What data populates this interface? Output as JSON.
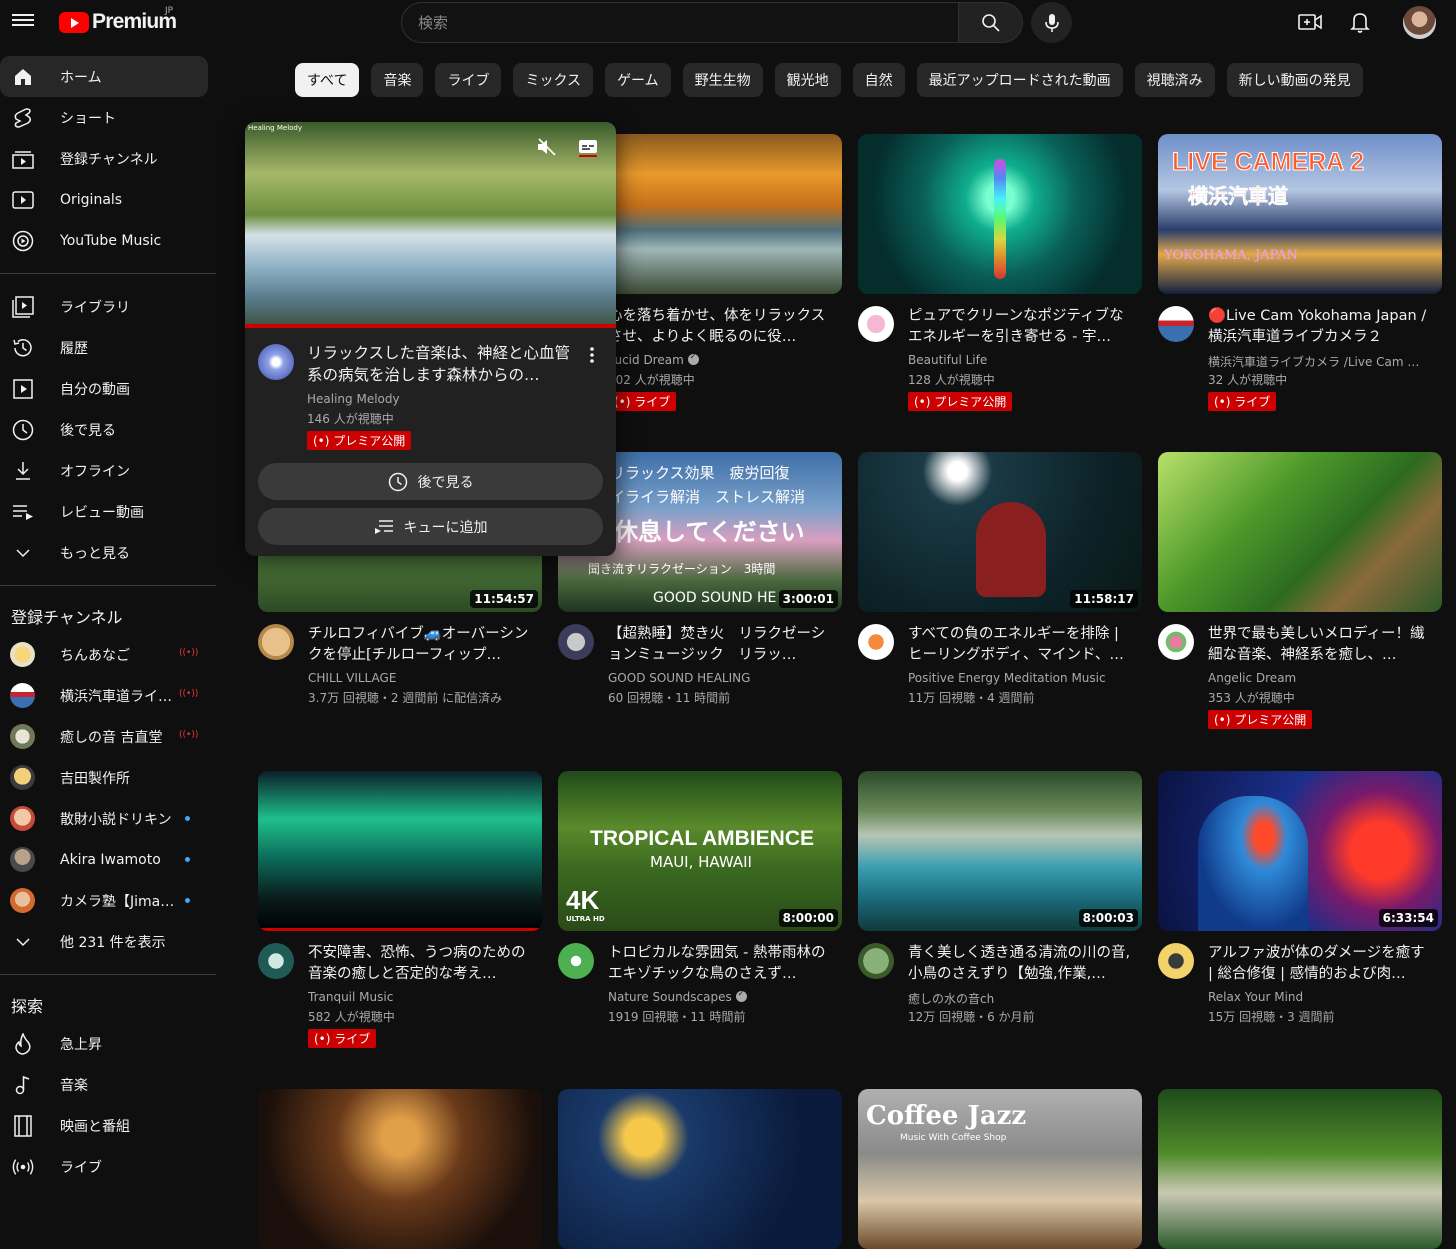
{
  "header": {
    "logo_text": "Premium",
    "region": "JP",
    "search_placeholder": "検索"
  },
  "sidebar": {
    "main": [
      {
        "label": "ホーム",
        "icon": "home-icon"
      },
      {
        "label": "ショート",
        "icon": "shorts-icon"
      },
      {
        "label": "登録チャンネル",
        "icon": "subscriptions-icon"
      },
      {
        "label": "Originals",
        "icon": "originals-icon"
      },
      {
        "label": "YouTube Music",
        "icon": "music-icon"
      }
    ],
    "library": [
      {
        "label": "ライブラリ",
        "icon": "library-icon"
      },
      {
        "label": "履歴",
        "icon": "history-icon"
      },
      {
        "label": "自分の動画",
        "icon": "my-videos-icon"
      },
      {
        "label": "後で見る",
        "icon": "watch-later-icon"
      },
      {
        "label": "オフライン",
        "icon": "download-icon"
      },
      {
        "label": "レビュー動画",
        "icon": "playlist-icon"
      },
      {
        "label": "もっと見る",
        "icon": "chevron-down-icon"
      }
    ],
    "subscriptions_heading": "登録チャンネル",
    "subscriptions": [
      {
        "label": "ちんあなご",
        "status": "live"
      },
      {
        "label": "横浜汽車道ライ…",
        "status": "live"
      },
      {
        "label": "癒しの音 吉直堂",
        "status": "live"
      },
      {
        "label": "吉田製作所",
        "status": ""
      },
      {
        "label": "散財小説ドリキン",
        "status": "new"
      },
      {
        "label": "Akira Iwamoto",
        "status": "new"
      },
      {
        "label": "カメラ塾【Jima…",
        "status": "new"
      }
    ],
    "show_more": "他 231 件を表示",
    "explore_heading": "探索",
    "explore": [
      {
        "label": "急上昇",
        "icon": "trending-icon"
      },
      {
        "label": "音楽",
        "icon": "music-note-icon"
      },
      {
        "label": "映画と番組",
        "icon": "film-icon"
      },
      {
        "label": "ライブ",
        "icon": "live-icon"
      }
    ]
  },
  "chips": [
    "すべて",
    "音楽",
    "ライブ",
    "ミックス",
    "ゲーム",
    "野生生物",
    "観光地",
    "自然",
    "最近アップロードされた動画",
    "視聴済み",
    "新しい動画の発見"
  ],
  "popup": {
    "tag": "Healing Melody",
    "title": "リラックスした音楽は、神経と心血管系の病気を治します森林からの…",
    "channel": "Healing Melody",
    "stats": "146 人が視聴中",
    "badge": "(•) プレミア公開",
    "watch_later": "後で見る",
    "add_queue": "キューに追加"
  },
  "videos": [
    {
      "title": "心を落ち着かせ、体をリラックスさせ、よりよく眠るのに役…",
      "channel": "Lucid Dream",
      "verified": true,
      "stats": "102 人が視聴中",
      "badge": "(•) ライブ",
      "duration": ""
    },
    {
      "title": "ピュアでクリーンなポジティブなエネルギーを引き寄せる - 宇…",
      "channel": "Beautiful Life",
      "verified": false,
      "stats": "128 人が視聴中",
      "badge": "(•) プレミア公開",
      "duration": ""
    },
    {
      "title": "🔴Live Cam Yokohama Japan / 横浜汽車道ライブカメラ２",
      "channel": "横浜汽車道ライブカメラ /Live Cam …",
      "verified": false,
      "stats": "32 人が視聴中",
      "badge": "(•) ライブ",
      "duration": "",
      "overlay1": "LIVE CAMERA 2",
      "overlay2": "横浜汽車道",
      "overlay3": "YOKOHAMA, JAPAN"
    },
    {
      "title": "チルロフィバイブ🚙オーバーシンクを停止[チルローフィップ…",
      "channel": "CHILL VILLAGE",
      "verified": false,
      "stats": "3.7万 回視聴・2 週間前 に配信済み",
      "badge": "",
      "duration": "11:54:57"
    },
    {
      "title": "【超熟睡】焚き火　リラクゼーションミュージック　リラッ…",
      "channel": "GOOD SOUND HEALING",
      "verified": false,
      "stats": "60 回視聴・11 時間前",
      "badge": "",
      "duration": "3:00:01",
      "overlay1": "リラックス効果　疲労回復",
      "overlay2": "イライラ解消　ストレス解消",
      "overlay3": "休息してください",
      "overlay4": "聞き流すリラクゼーション　3時間",
      "overlay5": "GOOD SOUND HE"
    },
    {
      "title": "すべての負のエネルギーを排除 | ヒーリングボディ、マインド、…",
      "channel": "Positive Energy Meditation Music",
      "verified": false,
      "stats": "11万 回視聴・4 週間前",
      "badge": "",
      "duration": "11:58:17"
    },
    {
      "title": "世界で最も美しいメロディー！繊細な音楽、神経系を癒し、…",
      "channel": "Angelic Dream",
      "verified": false,
      "stats": "353 人が視聴中",
      "badge": "(•) プレミア公開",
      "duration": ""
    },
    {
      "title": "不安障害、恐怖、うつ病のための音楽の癒しと否定的な考え…",
      "channel": "Tranquil Music",
      "verified": false,
      "stats": "582 人が視聴中",
      "badge": "(•) ライブ",
      "duration": ""
    },
    {
      "title": "トロピカルな雰囲気 - 熱帯雨林のエキゾチックな鳥のさえず…",
      "channel": "Nature Soundscapes",
      "verified": true,
      "stats": "1919 回視聴・11 時間前",
      "badge": "",
      "duration": "8:00:00",
      "overlay1": "TROPICAL AMBIENCE",
      "overlay2": "MAUI, HAWAII",
      "overlay3": "4K",
      "overlay4": "ULTRA HD"
    },
    {
      "title": "青く美しく透き通る清流の川の音,小鳥のさえずり【勉強,作業,…",
      "channel": "癒しの水の音ch",
      "verified": false,
      "stats": "12万 回視聴・6 か月前",
      "badge": "",
      "duration": "8:00:03"
    },
    {
      "title": "アルファ波が体のダメージを癒す | 総合修復 | 感情的および肉…",
      "channel": "Relax Your Mind",
      "verified": false,
      "stats": "15万 回視聴・3 週間前",
      "badge": "",
      "duration": "6:33:54"
    }
  ],
  "bottom_row": [
    {
      "overlay1": ""
    },
    {
      "overlay1": ""
    },
    {
      "overlay1": "Coffee Jazz",
      "overlay2": "Music With Coffee Shop"
    },
    {
      "overlay1": ""
    }
  ]
}
